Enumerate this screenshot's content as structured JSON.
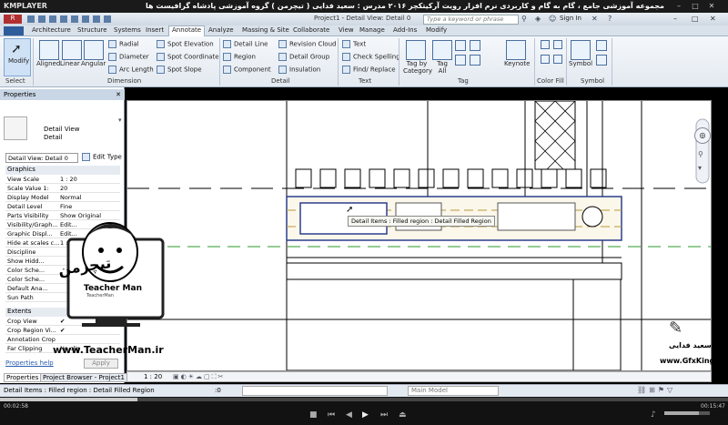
{
  "player": {
    "logo": "KMPLAYER",
    "title": "مجموعه آموزشی جامع ، گام به گام و کاربردی نرم افزار رویت آرکیتکچر ۲۰۱۶ مدرس : سعید فدایی ( تیچرمن ) گروه آموزشی پادشاه گرافیست ها",
    "time_current": "00:02:58",
    "time_total": "00:15:47"
  },
  "revit": {
    "app_title": "Project1 - Detail View: Detail 0",
    "search_placeholder": "Type a keyword or phrase",
    "signin": "Sign In",
    "tabs": [
      "Architecture",
      "Structure",
      "Systems",
      "Insert",
      "Annotate",
      "Analyze",
      "Massing & Site",
      "Collaborate",
      "View",
      "Manage",
      "Add-Ins",
      "Modify"
    ],
    "active_tab": "Annotate",
    "ribbon": {
      "modify": "Modify",
      "select": "Select",
      "dimension_buttons": [
        "Aligned",
        "Linear",
        "Angular"
      ],
      "radial": "Radial",
      "diameter": "Diameter",
      "arc_length": "Arc Length",
      "spot_elevation": "Spot Elevation",
      "spot_coordinate": "Spot Coordinate",
      "spot_slope": "Spot Slope",
      "dimension_panel": "Dimension",
      "detail_line": "Detail Line",
      "region": "Region",
      "component": "Component",
      "revision_cloud": "Revision Cloud",
      "detail_group": "Detail Group",
      "insulation": "Insulation",
      "detail_panel": "Detail",
      "text": "Text",
      "check_spelling": "Check Spelling",
      "find_replace": "Find/ Replace",
      "text_panel": "Text",
      "tag_by_category": "Tag by Category",
      "tag_all": "Tag All",
      "keynote": "Keynote",
      "tag_panel": "Tag",
      "color_fill_panel": "Color Fill",
      "symbol": "Symbol",
      "symbol_panel": "Symbol"
    },
    "properties": {
      "header": "Properties",
      "type_name": "Detail View",
      "type_sub": "Detail",
      "selector": "Detail View: Detail 0",
      "edit_type": "Edit Type",
      "section_graphics": "Graphics",
      "rows": [
        {
          "k": "View Scale",
          "v": "1 : 20"
        },
        {
          "k": "Scale Value 1:",
          "v": "20"
        },
        {
          "k": "Display Model",
          "v": "Normal"
        },
        {
          "k": "Detail Level",
          "v": "Fine"
        },
        {
          "k": "Parts Visibility",
          "v": "Show Original"
        },
        {
          "k": "Visibility/Graph...",
          "v": "Edit..."
        },
        {
          "k": "Graphic Displ...",
          "v": "Edit..."
        },
        {
          "k": "Hide at scales c...",
          "v": "1 : 100"
        },
        {
          "k": "Discipline",
          "v": ""
        },
        {
          "k": "Show Hidd...",
          "v": ""
        },
        {
          "k": "Color Sche...",
          "v": ""
        },
        {
          "k": "Color Sche...",
          "v": ""
        },
        {
          "k": "Default Ana...",
          "v": ""
        },
        {
          "k": "Sun Path",
          "v": ""
        }
      ],
      "section_extents": "Extents",
      "rows2": [
        {
          "k": "Crop View",
          "v": "✔"
        },
        {
          "k": "Crop Region Vi...",
          "v": "✔"
        },
        {
          "k": "Annotation Crop",
          "v": ""
        },
        {
          "k": "Far Clipping",
          "v": "No clip"
        }
      ],
      "help": "Properties help",
      "apply": "Apply",
      "tab_properties": "Properties",
      "tab_browser": "Project Browser - Project1"
    },
    "tooltip": "Detail Items : Filled region : Detail Filled Region",
    "view_scale": "1 : 20",
    "status_text": "Detail Items : Filled region : Detail Filled Region",
    "model_select": "Main Model",
    "status_zero": ":0"
  },
  "watermark": {
    "teacher": "TeacherMan",
    "site": "www.TeacherMan.ir",
    "logo_fa": "تیچرمن",
    "logo_sub": "Teacher Man",
    "gfx_name": "سعید فدایی",
    "gfx_site": "www.GfxKing.ir"
  }
}
